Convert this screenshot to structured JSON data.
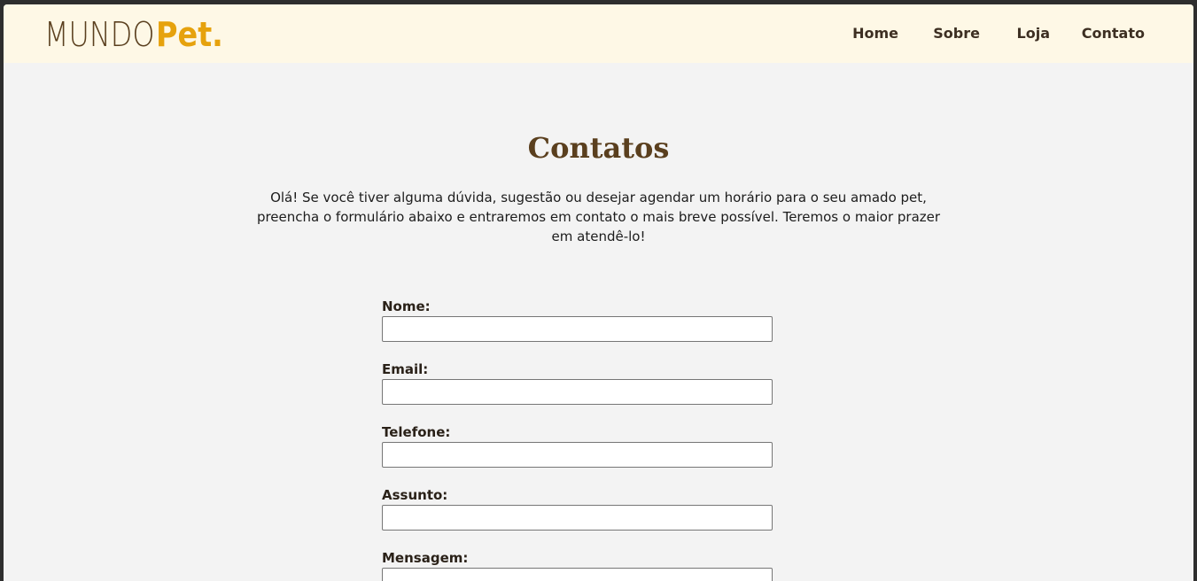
{
  "header": {
    "logo_part1": "MUNDO",
    "logo_part2": "Pet.",
    "nav": [
      "Home",
      "Sobre",
      "Loja",
      "Contato"
    ]
  },
  "page": {
    "title": "Contatos",
    "intro": "Olá! Se você tiver alguma dúvida, sugestão ou desejar agendar um horário para o seu amado pet, preencha o formulário abaixo e entraremos em contato o mais breve possível. Teremos o maior prazer em atendê-lo!"
  },
  "form": {
    "fields": [
      {
        "label": "Nome:",
        "value": ""
      },
      {
        "label": "Email:",
        "value": ""
      },
      {
        "label": "Telefone:",
        "value": ""
      },
      {
        "label": "Assunto:",
        "value": ""
      },
      {
        "label": "Mensagem:",
        "value": ""
      }
    ]
  },
  "colors": {
    "header_bg": "#fef8e6",
    "brand_brown": "#5a3f1e",
    "brand_gold": "#e6a20d",
    "page_bg": "#f3f3f3"
  }
}
